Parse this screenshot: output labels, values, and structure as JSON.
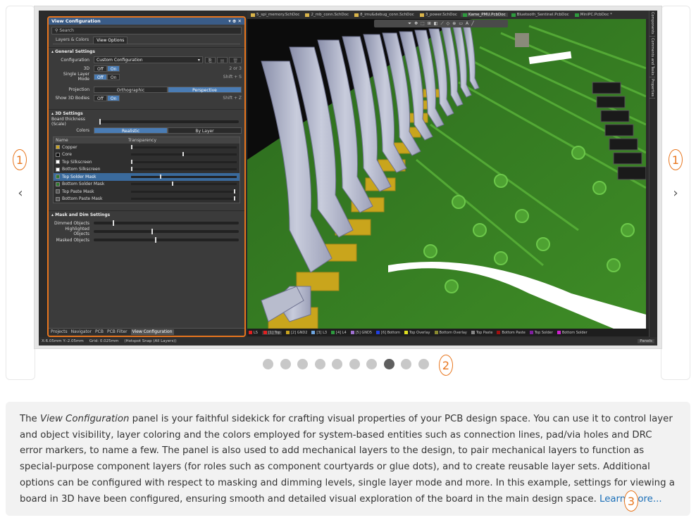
{
  "callouts": {
    "left": "1",
    "right": "1",
    "dots": "2",
    "caption": "3"
  },
  "nav": {
    "prev_icon": "‹",
    "next_icon": "›"
  },
  "panel": {
    "title": "View Configuration",
    "title_icons": "▾ ⊕ ✕",
    "search_placeholder": "Search",
    "tabs": [
      "Layers & Colors",
      "View Options"
    ],
    "general": {
      "header": "General Settings",
      "configuration_label": "Configuration",
      "configuration_value": "Custom Configuration",
      "3d_label": "3D",
      "3d_off": "Off",
      "3d_on": "On",
      "3d_shortcut": "2 or 3",
      "single_layer_label": "Single Layer Mode",
      "single_off": "Off",
      "single_on": "On",
      "single_shortcut": "Shift + S",
      "projection_label": "Projection",
      "projection_ortho": "Orthographic",
      "projection_persp": "Perspective",
      "show3d_label": "Show 3D Bodies",
      "show3d_off": "Off",
      "show3d_on": "On",
      "show3d_shortcut": "Shift + Z"
    },
    "settings3d": {
      "header": "3D Settings",
      "thickness_label": "Board thickness (Scale)",
      "colors_label": "Colors",
      "colors_realistic": "Realistic",
      "colors_bylayer": "By Layer",
      "table_name_header": "Name",
      "table_transparency_header": "Transparency",
      "layers": [
        {
          "name": "Copper",
          "color": "#c8a21e",
          "transparency": 0.0
        },
        {
          "name": "Core",
          "color": "#111111",
          "transparency": 0.5
        },
        {
          "name": "Top Silkscreen",
          "color": "#ffffff",
          "transparency": 0.0
        },
        {
          "name": "Bottom Silkscreen",
          "color": "#ffffff",
          "transparency": 0.0
        },
        {
          "name": "Top Solder Mask",
          "color": "#2e7a2e",
          "transparency": 0.28
        },
        {
          "name": "Bottom Solder Mask",
          "color": "#2e7a2e",
          "transparency": 0.4
        },
        {
          "name": "Top Paste Mask",
          "color": "#555555",
          "transparency": 1.0
        },
        {
          "name": "Bottom Paste Mask",
          "color": "#555555",
          "transparency": 1.0
        }
      ]
    },
    "mask": {
      "header": "Mask and Dim Settings",
      "dimmed_label": "Dimmed Objects",
      "dimmed_value": 0.13,
      "highlighted_label": "Highlighted Objects",
      "highlighted_value": 0.4,
      "masked_label": "Masked Objects",
      "masked_value": 0.42
    },
    "bottom_tabs": [
      "Projects",
      "Navigator",
      "PCB",
      "PCB Filter",
      "View Configuration"
    ]
  },
  "doc_tabs": [
    {
      "label": "5_spi_memory.SchDoc",
      "kind": "sch"
    },
    {
      "label": "2_mb_conn.SchDoc",
      "kind": "sch"
    },
    {
      "label": "8_imu&debug_conn.SchDoc",
      "kind": "sch"
    },
    {
      "label": "3_power.SchDoc",
      "kind": "sch"
    },
    {
      "label": "Kame_PMU.PcbDoc",
      "kind": "pcb"
    },
    {
      "label": "Bluetooth_Sentinel.PcbDoc",
      "kind": "pcb"
    },
    {
      "label": "MiniPC.PcbDoc *",
      "kind": "pcb"
    }
  ],
  "right_panels": [
    "Components",
    "Comments and Tasks",
    "Properties"
  ],
  "layer_bar": [
    {
      "label": "LS",
      "color": "#e02020"
    },
    {
      "label": "[1] Top",
      "color": "#e02020"
    },
    {
      "label": "[2] GND2",
      "color": "#c8a21e"
    },
    {
      "label": "[3] L3",
      "color": "#6fa6e0"
    },
    {
      "label": "[4] L4",
      "color": "#2e9a3e"
    },
    {
      "label": "[5] GND5",
      "color": "#a070d0"
    },
    {
      "label": "[6] Bottom",
      "color": "#2040e0"
    },
    {
      "label": "Top Overlay",
      "color": "#e0e020"
    },
    {
      "label": "Bottom Overlay",
      "color": "#8a8a30"
    },
    {
      "label": "Top Paste",
      "color": "#888888"
    },
    {
      "label": "Bottom Paste",
      "color": "#a01010"
    },
    {
      "label": "Top Solder",
      "color": "#8020a0"
    },
    {
      "label": "Bottom Solder",
      "color": "#d020d0"
    }
  ],
  "status": {
    "coords": "X:6.05mm Y:-2.05mm",
    "grid": "Grid: 0.025mm",
    "snap": "(Hotspot Snap (All Layers))",
    "panels_button": "Panels"
  },
  "carousel": {
    "count": 10,
    "active_index": 7
  },
  "caption": {
    "text_before": "The ",
    "italic": "View Configuration",
    "text_after": " panel is your faithful sidekick for crafting visual properties of your PCB design space. You can use it to control layer and object visibility, layer coloring and the colors employed for system-based entities such as connection lines, pad/via holes and DRC error markers, to name a few. The panel is also used to add mechanical layers to the design, to pair mechanical layers to function as special-purpose component layers (for roles such as component courtyards or glue dots), and to create reusable layer sets. Additional options can be configured with respect to masking and dimming levels, single layer mode and more. In this example, settings for viewing a board in 3D have been configured, ensuring smooth and detailed visual exploration of the board in the main design space. ",
    "link": "Learn more..."
  }
}
